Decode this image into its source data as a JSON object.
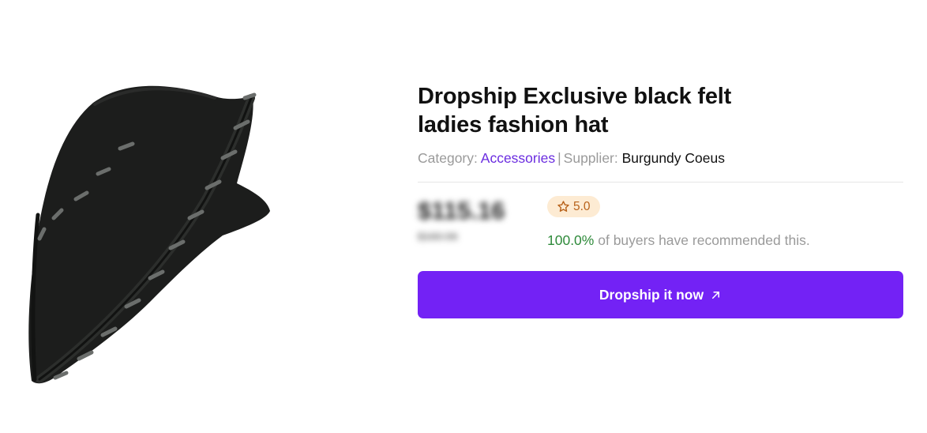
{
  "product": {
    "title": "Dropship Exclusive black felt ladies fashion hat",
    "image_alt": "black felt hat",
    "category_label": "Category:",
    "category_value": "Accessories",
    "separator": "|",
    "supplier_label": "Supplier:",
    "supplier_value": "Burgundy Coeus",
    "price": "$115.16",
    "old_price": "$160.96",
    "rating": "5.0",
    "recommend_pct": "100.0%",
    "recommend_text": "of buyers have recommended this.",
    "cta_label": "Dropship it now"
  },
  "icons": {
    "rating": "star-icon",
    "cta": "arrow-up-right-icon"
  },
  "colors": {
    "accent": "#7322f5",
    "link": "#6b2de0",
    "rating_bg": "#fdebd3",
    "rating_fg": "#b8621a",
    "recommend_pct": "#2e8a3a"
  }
}
